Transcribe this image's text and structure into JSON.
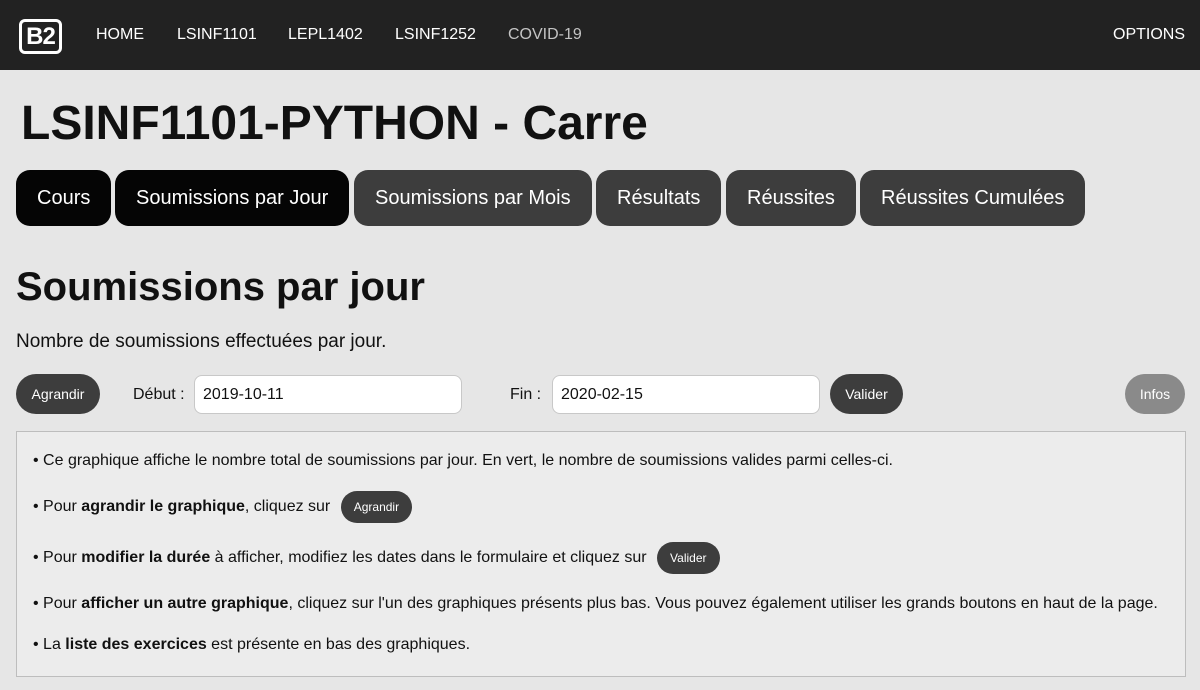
{
  "nav": {
    "logo": "B2",
    "items": [
      {
        "label": "HOME"
      },
      {
        "label": "LSINF1101"
      },
      {
        "label": "LEPL1402"
      },
      {
        "label": "LSINF1252"
      },
      {
        "label": "COVID-19"
      }
    ],
    "options": "OPTIONS"
  },
  "page": {
    "title": "LSINF1101-PYTHON - Carre"
  },
  "tabs": [
    {
      "label": "Cours",
      "active": true
    },
    {
      "label": "Soumissions par Jour",
      "active": true
    },
    {
      "label": "Soumissions par Mois",
      "active": false
    },
    {
      "label": "Résultats",
      "active": false
    },
    {
      "label": "Réussites",
      "active": false
    },
    {
      "label": "Réussites Cumulées",
      "active": false
    }
  ],
  "section": {
    "title": "Soumissions par jour",
    "description": "Nombre de soumissions effectuées par jour."
  },
  "form": {
    "enlarge_label": "Agrandir",
    "start_label": "Début :",
    "start_value": "2019-10-11",
    "end_label": "Fin :",
    "end_value": "2020-02-15",
    "validate_label": "Valider",
    "info_label": "Infos"
  },
  "info": {
    "line1": "• Ce graphique affiche le nombre total de soumissions par jour. En vert, le nombre de soumissions valides parmi celles-ci.",
    "line2_pre": "• Pour ",
    "line2_bold": "agrandir le graphique",
    "line2_post": ", cliquez sur",
    "line2_button": "Agrandir",
    "line3_pre": "• Pour ",
    "line3_bold": "modifier la durée",
    "line3_post": " à afficher, modifiez les dates dans le formulaire et cliquez sur",
    "line3_button": "Valider",
    "line4_pre": "• Pour ",
    "line4_bold": "afficher un autre graphique",
    "line4_post": ", cliquez sur l'un des graphiques présents plus bas. Vous pouvez également utiliser les grands boutons en haut de la page.",
    "line5_pre": "• La ",
    "line5_bold": "liste des exercices",
    "line5_post": " est présente en bas des graphiques."
  },
  "colors": {
    "topbar": "#222222",
    "tab": "#3d3d3d",
    "tab_active": "#050505",
    "background": "#e6e6e6",
    "info_button": "#8a8a8a"
  }
}
